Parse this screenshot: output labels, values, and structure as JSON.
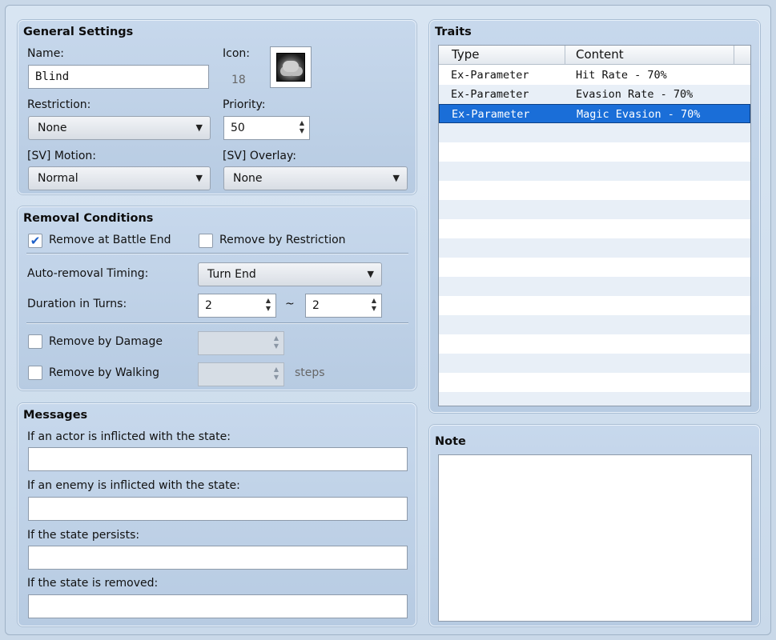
{
  "general": {
    "title": "General Settings",
    "name_label": "Name:",
    "name_value": "Blind",
    "icon_label": "Icon:",
    "icon_index": "18",
    "restriction_label": "Restriction:",
    "restriction_value": "None",
    "priority_label": "Priority:",
    "priority_value": "50",
    "sv_motion_label": "[SV] Motion:",
    "sv_motion_value": "Normal",
    "sv_overlay_label": "[SV] Overlay:",
    "sv_overlay_value": "None"
  },
  "removal": {
    "title": "Removal Conditions",
    "remove_battle_end_label": "Remove at Battle End",
    "remove_battle_end_checked": true,
    "remove_restriction_label": "Remove by Restriction",
    "remove_restriction_checked": false,
    "auto_timing_label": "Auto-removal Timing:",
    "auto_timing_value": "Turn End",
    "duration_label": "Duration in Turns:",
    "duration_min": "2",
    "duration_tilde": "~",
    "duration_max": "2",
    "remove_damage_label": "Remove by Damage",
    "remove_damage_checked": false,
    "remove_walking_label": "Remove by Walking",
    "remove_walking_checked": false,
    "steps_label": "steps"
  },
  "messages": {
    "title": "Messages",
    "actor_label": "If an actor is inflicted with the state:",
    "actor_value": "",
    "enemy_label": "If an enemy is inflicted with the state:",
    "enemy_value": "",
    "persists_label": "If the state persists:",
    "persists_value": "",
    "removed_label": "If the state is removed:",
    "removed_value": ""
  },
  "traits": {
    "title": "Traits",
    "col_type": "Type",
    "col_content": "Content",
    "rows": [
      {
        "type": "Ex-Parameter",
        "content": "Hit Rate - 70%"
      },
      {
        "type": "Ex-Parameter",
        "content": "Evasion Rate - 70%"
      },
      {
        "type": "Ex-Parameter",
        "content": "Magic Evasion - 70%"
      }
    ],
    "selected_index": 2
  },
  "note": {
    "title": "Note",
    "value": ""
  },
  "icons": {
    "check": "✔",
    "dropdown": "▼",
    "spin_up": "▲",
    "spin_down": "▼"
  }
}
